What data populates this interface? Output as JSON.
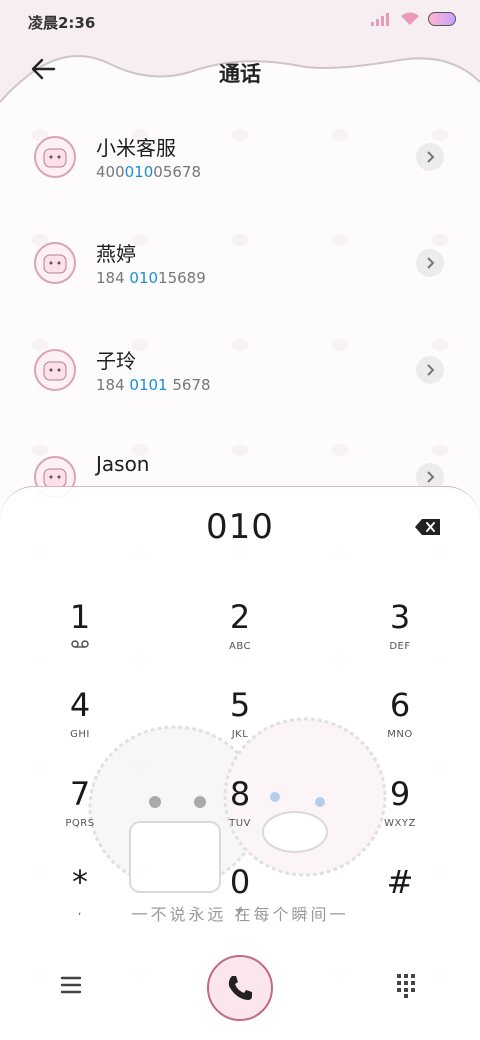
{
  "status_bar": {
    "time": "凌晨2:36"
  },
  "header": {
    "title": "通话"
  },
  "contacts": [
    {
      "name": "小米客服",
      "number_pre": "400",
      "number_hl": "010",
      "number_post": "05678"
    },
    {
      "name": "燕婷",
      "number_pre": "184 ",
      "number_hl": "010",
      "number_post": "15689"
    },
    {
      "name": "子玲",
      "number_pre": "184 ",
      "number_hl": "0101",
      "number_post": " 5678"
    },
    {
      "name": "Jason",
      "number_pre": "",
      "number_hl": "",
      "number_post": ""
    }
  ],
  "dialer": {
    "number": "010",
    "keys": [
      {
        "digit": "1",
        "letters": ""
      },
      {
        "digit": "2",
        "letters": "ABC"
      },
      {
        "digit": "3",
        "letters": "DEF"
      },
      {
        "digit": "4",
        "letters": "GHI"
      },
      {
        "digit": "5",
        "letters": "JKL"
      },
      {
        "digit": "6",
        "letters": "MNO"
      },
      {
        "digit": "7",
        "letters": "PQRS"
      },
      {
        "digit": "8",
        "letters": "TUV"
      },
      {
        "digit": "9",
        "letters": "WXYZ"
      },
      {
        "digit": "*",
        "letters": ","
      },
      {
        "digit": "0",
        "letters": "+"
      },
      {
        "digit": "#",
        "letters": ""
      }
    ],
    "caption": "一不说永远 在每个瞬间一"
  },
  "icons": {
    "back": "arrow-left-icon",
    "backspace": "backspace-icon",
    "voicemail": "voicemail-icon",
    "menu": "menu-icon",
    "call": "phone-icon",
    "keypad": "keypad-icon"
  },
  "colors": {
    "highlight": "#1a8fd6",
    "accent_pink": "#c06a86"
  }
}
